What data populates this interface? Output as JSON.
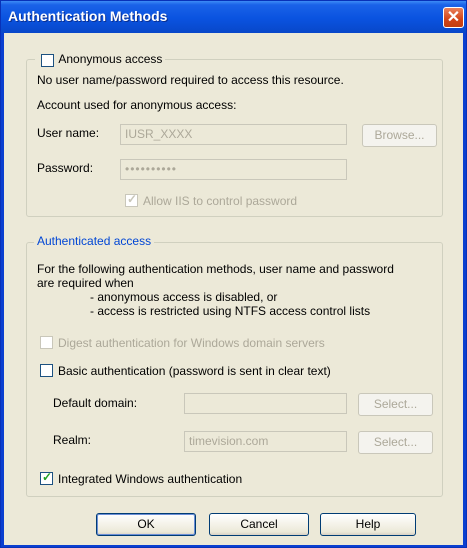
{
  "window": {
    "title": "Authentication Methods",
    "close_glyph": "✕"
  },
  "anonymous": {
    "group_label": "Anonymous access",
    "checked": false,
    "description": "No user name/password required to access this resource.",
    "account_label": "Account used for anonymous access:",
    "username_label": "User name:",
    "username_value": "IUSR_XXXX",
    "browse_label": "Browse...",
    "password_label": "Password:",
    "password_value": "••••••••••",
    "allow_iis_label": "Allow IIS to control password",
    "allow_iis_checked": true
  },
  "authenticated": {
    "group_label": "Authenticated access",
    "description_lines": [
      "For the following authentication methods, user name and password",
      "are required when",
      "- anonymous access is disabled, or",
      "- access is restricted using NTFS access control lists"
    ],
    "digest_label": "Digest authentication for Windows domain servers",
    "digest_checked": false,
    "basic_label": "Basic authentication (password is sent in clear text)",
    "basic_checked": false,
    "default_domain_label": "Default domain:",
    "default_domain_value": "",
    "select_label": "Select...",
    "realm_label": "Realm:",
    "realm_value": "timevision.com",
    "integrated_label": "Integrated Windows authentication",
    "integrated_checked": true
  },
  "buttons": {
    "ok": "OK",
    "cancel": "Cancel",
    "help": "Help"
  },
  "check_glyph": "✓"
}
